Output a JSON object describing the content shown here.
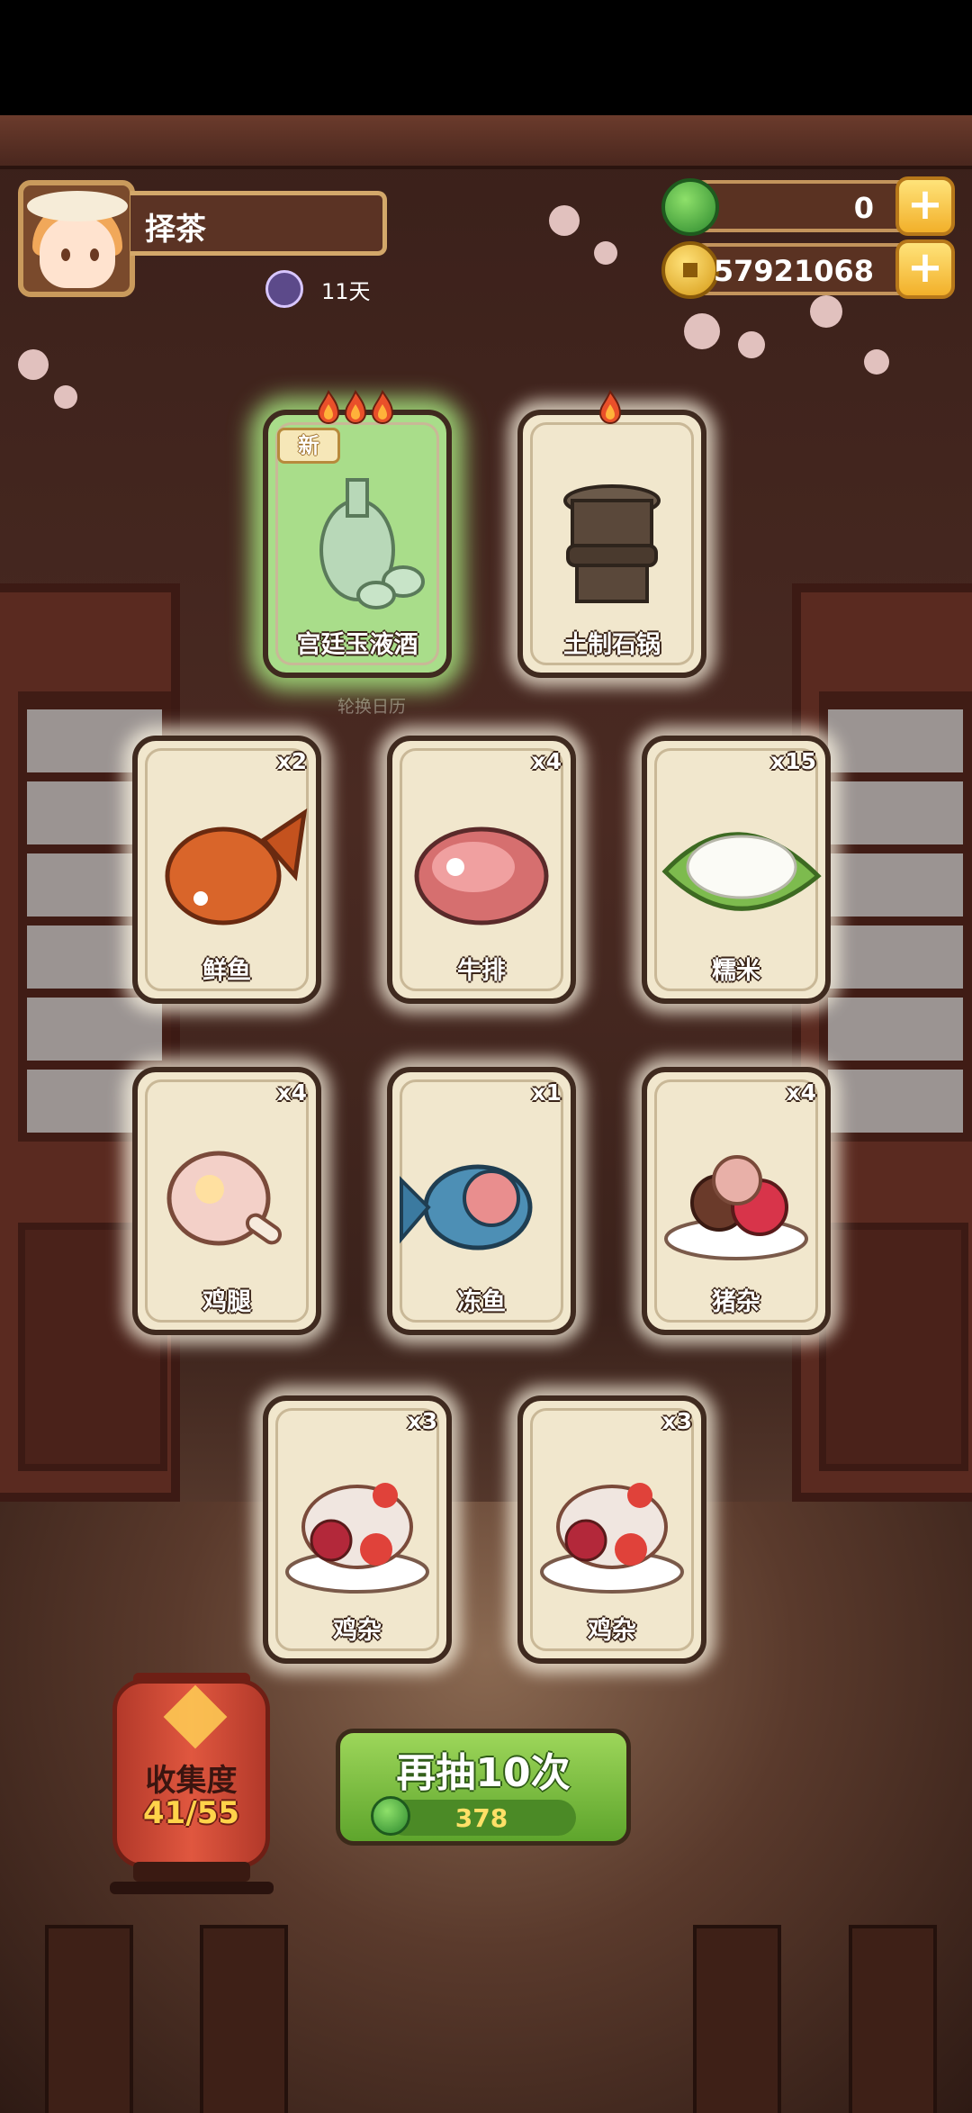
{
  "player": {
    "name": "择茶",
    "days": "11天"
  },
  "resources": {
    "jade": "0",
    "coins": "57921068",
    "plus": "+"
  },
  "banner": {
    "calendar_label": "轮换日历"
  },
  "cards": [
    {
      "label": "宫廷玉液酒",
      "count": "",
      "badge": "新",
      "flames": 3,
      "icon": "wine-set-icon",
      "glow": true
    },
    {
      "label": "土制石锅",
      "count": "",
      "badge": "",
      "flames": 1,
      "icon": "stone-pot-icon",
      "glow": false
    },
    {
      "label": "鲜鱼",
      "count": "x2",
      "icon": "fish-icon"
    },
    {
      "label": "牛排",
      "count": "x4",
      "icon": "steak-icon"
    },
    {
      "label": "糯米",
      "count": "x15",
      "icon": "rice-icon"
    },
    {
      "label": "鸡腿",
      "count": "x4",
      "icon": "drumstick-icon"
    },
    {
      "label": "冻鱼",
      "count": "x1",
      "icon": "frozen-fish-icon"
    },
    {
      "label": "猪杂",
      "count": "x4",
      "icon": "pork-offal-icon"
    },
    {
      "label": "鸡杂",
      "count": "x3",
      "icon": "chicken-offal-icon"
    },
    {
      "label": "鸡杂",
      "count": "x3",
      "icon": "chicken-offal-icon"
    }
  ],
  "collection": {
    "title": "收集度",
    "count": "41/55"
  },
  "draw_button": {
    "label": "再抽10次",
    "cost": "378"
  },
  "colors": {
    "card_bg": "#f1e7cd",
    "card_border": "#3f2a1f",
    "button_green": "#7cbf42",
    "lantern_red": "#d24a35"
  }
}
